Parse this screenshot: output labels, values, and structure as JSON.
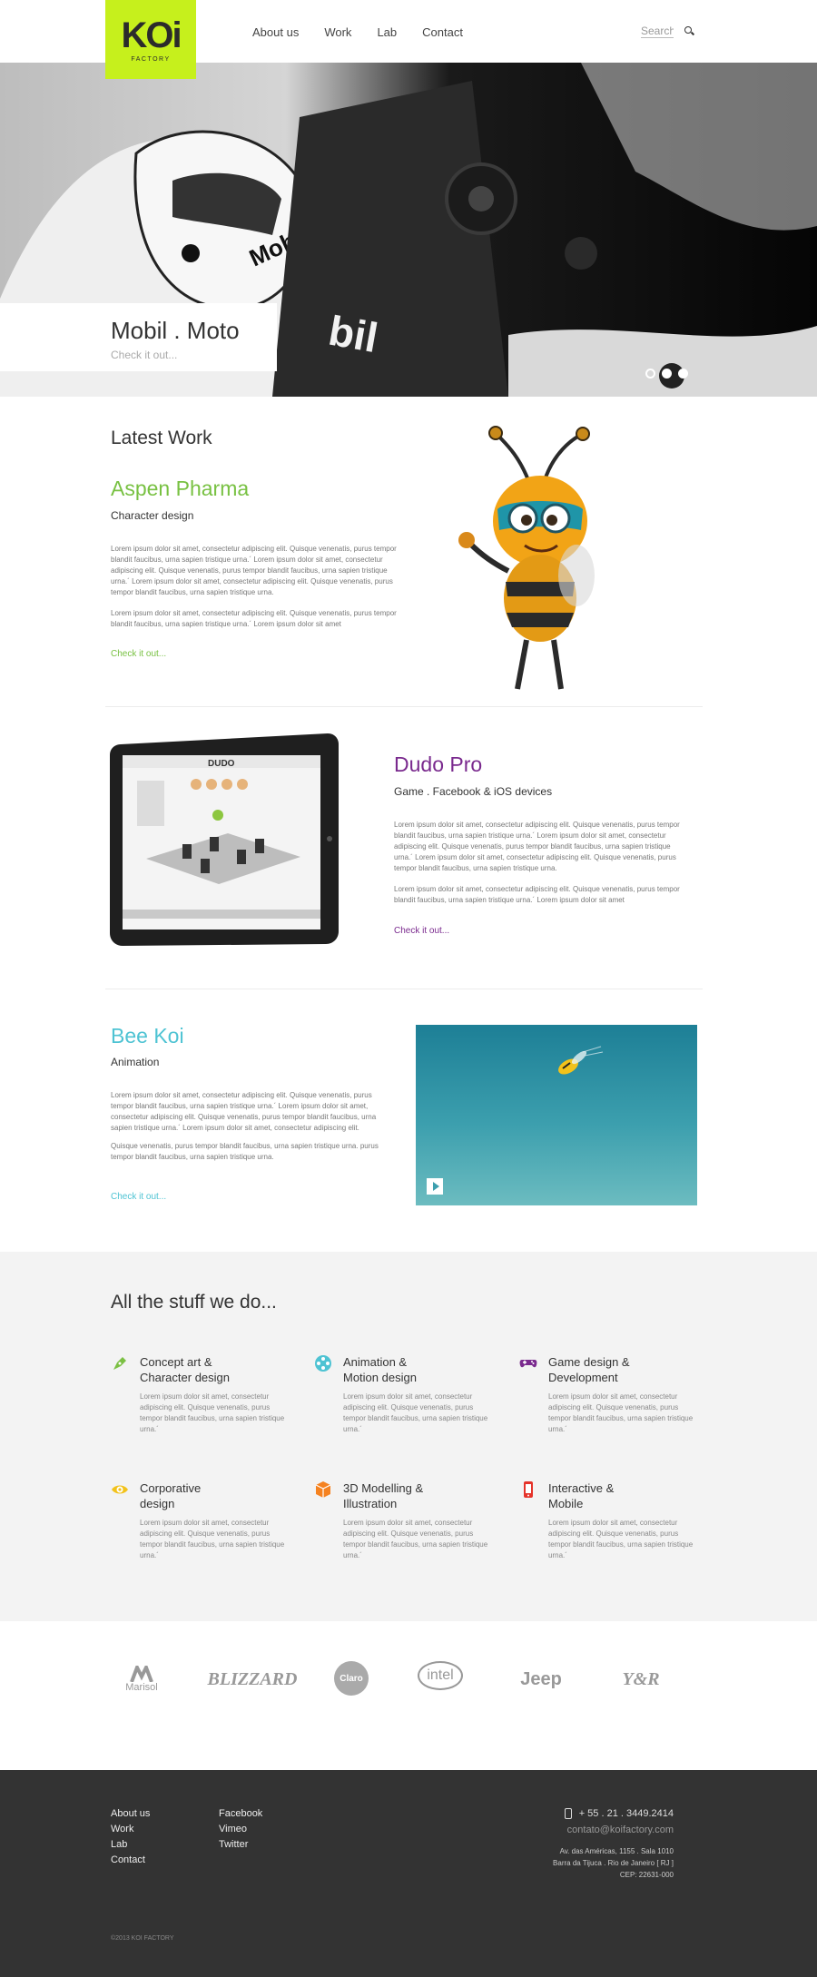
{
  "header": {
    "logo_text": "KOi",
    "logo_sub": "FACTORY",
    "nav": [
      "About us",
      "Work",
      "Lab",
      "Contact"
    ],
    "search_placeholder": "Search"
  },
  "hero": {
    "title": "Mobil . Moto",
    "link": "Check it out...",
    "slides": 3,
    "active_slide": 1
  },
  "latest": {
    "heading": "Latest Work",
    "items": [
      {
        "title": "Aspen Pharma",
        "subtitle": "Character design",
        "p1": "Lorem ipsum dolor sit amet, consectetur adipiscing elit. Quisque venenatis, purus tempor blandit faucibus, urna sapien tristique urna.´ Lorem ipsum dolor sit amet, consectetur adipiscing elit. Quisque venenatis, purus tempor blandit faucibus, urna sapien tristique urna.´ Lorem ipsum dolor sit amet, consectetur adipiscing elit. Quisque venenatis, purus tempor blandit faucibus, urna sapien tristique urna.",
        "p2": "Lorem ipsum dolor sit amet, consectetur adipiscing elit. Quisque venenatis, purus tempor blandit faucibus, urna sapien tristique urna.´ Lorem ipsum dolor sit amet",
        "link": "Check it out...",
        "color": "#78c142"
      },
      {
        "title": "Dudo Pro",
        "subtitle": "Game . Facebook & iOS devices",
        "p1": "Lorem ipsum dolor sit amet, consectetur adipiscing elit. Quisque venenatis, purus tempor blandit faucibus, urna sapien tristique urna.´ Lorem ipsum dolor sit amet, consectetur adipiscing elit. Quisque venenatis, purus tempor blandit faucibus, urna sapien tristique urna.´ Lorem ipsum dolor sit amet, consectetur adipiscing elit. Quisque venenatis, purus tempor blandit faucibus, urna sapien tristique urna.",
        "p2": "Lorem ipsum dolor sit amet, consectetur adipiscing elit. Quisque venenatis, purus tempor blandit faucibus, urna sapien tristique urna.´ Lorem ipsum dolor sit amet",
        "link": "Check it out...",
        "color": "#7a2a8e",
        "tablet_logo": "DUDO"
      },
      {
        "title": "Bee Koi",
        "subtitle": "Animation",
        "p1": "Lorem ipsum dolor sit amet, consectetur adipiscing elit. Quisque venenatis, purus tempor blandit faucibus, urna sapien tristique urna.´ Lorem ipsum dolor sit amet, consectetur adipiscing elit. Quisque venenatis, purus tempor blandit faucibus, urna sapien tristique urna.´ Lorem ipsum dolor sit amet, consectetur adipiscing elit.",
        "p2": "Quisque venenatis, purus tempor blandit faucibus, urna sapien tristique urna. purus tempor blandit faucibus, urna sapien tristique urna.",
        "link": "Check it out...",
        "color": "#4ec3d3"
      }
    ]
  },
  "services": {
    "heading": "All the stuff we do...",
    "items": [
      {
        "title1": "Concept art &",
        "title2": "Character design",
        "icon": "pen-nib-icon",
        "color": "#7bc043"
      },
      {
        "title1": "Animation &",
        "title2": "Motion design",
        "icon": "film-reel-icon",
        "color": "#4ec3d3"
      },
      {
        "title1": "Game design &",
        "title2": "Development",
        "icon": "gamepad-icon",
        "color": "#7a2a8e"
      },
      {
        "title1": "Corporative",
        "title2": "design",
        "icon": "eye-icon",
        "color": "#f2c21b"
      },
      {
        "title1": "3D Modelling &",
        "title2": "Illustration",
        "icon": "cube-icon",
        "color": "#f58220"
      },
      {
        "title1": "Interactive &",
        "title2": "Mobile",
        "icon": "mobile-icon",
        "color": "#e5332a"
      }
    ],
    "body": "Lorem ipsum dolor sit amet, consectetur adipiscing elit. Quisque venenatis, purus tempor blandit faucibus, urna sapien tristique urna.´"
  },
  "clients": [
    "Marisol",
    "BLIZZARD",
    "Claro",
    "intel",
    "Jeep",
    "Y&R"
  ],
  "footer": {
    "col1": [
      "About us",
      "Work",
      "Lab",
      "Contact"
    ],
    "col2": [
      "Facebook",
      "Vimeo",
      "Twitter"
    ],
    "phone": "+ 55 . 21 . 3449.2414",
    "email": "contato@koifactory.com",
    "address1": "Av. das Américas, 1155 . Sala 1010",
    "address2": "Barra da Tijuca . Rio de Janeiro [ RJ ]",
    "address3": "CEP: 22631-000",
    "copyright": "©2013 KOI FACTORY"
  }
}
